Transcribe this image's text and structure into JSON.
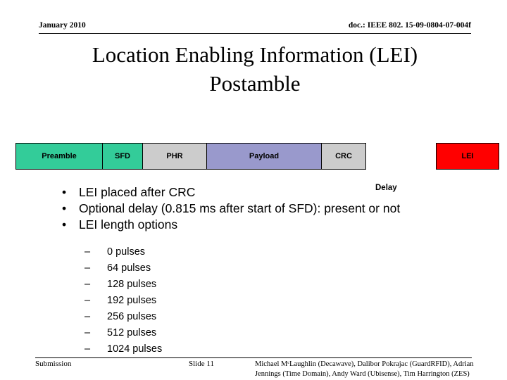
{
  "header": {
    "date": "January 2010",
    "doc_id": "doc.: IEEE 802. 15-09-0804-07-004f"
  },
  "title": {
    "line1": "Location Enabling Information (LEI)",
    "line2": "Postamble"
  },
  "frame_diagram": {
    "cells": [
      {
        "label": "Preamble",
        "color": "#33cc99"
      },
      {
        "label": "SFD",
        "color": "#33cc99"
      },
      {
        "label": "PHR",
        "color": "#cccccc"
      },
      {
        "label": "Payload",
        "color": "#9999cc"
      },
      {
        "label": "CRC",
        "color": "#cccccc"
      },
      {
        "label": "LEI",
        "color": "#ff0000"
      }
    ],
    "delay_label": "Delay"
  },
  "bullets": {
    "level1": [
      {
        "mark": "•",
        "text": "LEI placed after CRC"
      },
      {
        "mark": "•",
        "text": "Optional delay (0.815 ms after start of SFD): present or not"
      },
      {
        "mark": "•",
        "text": "LEI length options"
      }
    ],
    "level2": [
      {
        "mark": "–",
        "text": "0 pulses"
      },
      {
        "mark": "–",
        "text": "64 pulses"
      },
      {
        "mark": "–",
        "text": "128 pulses"
      },
      {
        "mark": "–",
        "text": "192 pulses"
      },
      {
        "mark": "–",
        "text": "256 pulses"
      },
      {
        "mark": "–",
        "text": "512 pulses"
      },
      {
        "mark": "–",
        "text": "1024 pulses"
      }
    ]
  },
  "footer": {
    "left": "Submission",
    "center": "Slide 11",
    "right_line1": "Michael MᶜLaughlin (Decawave), Dalibor Pokrajac (GuardRFID), Adrian",
    "right_line2": "Jennings (Time Domain), Andy Ward (Ubisense), Tim Harrington (ZES)"
  }
}
